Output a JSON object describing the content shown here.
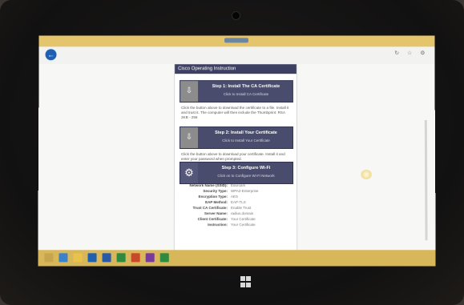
{
  "browser": {
    "url": "",
    "back_icon": "arrow-left-icon",
    "tools_icons": [
      "refresh-icon",
      "favorites-icon",
      "settings-icon"
    ]
  },
  "page": {
    "header_title": "Cisco Operating Instruction",
    "steps": [
      {
        "title": "Step 1: Install The CA Certificate",
        "subtitle": "Click to Install CA Certificate",
        "icon": "download-icon"
      },
      {
        "title": "Step 2: Install Your Certificate",
        "subtitle": "Click to Install Your Certificate",
        "icon": "download-icon"
      },
      {
        "title": "Step 3: Configure Wi-Fi",
        "subtitle": "Click on to Configure Wi-Fi Network",
        "icon": "gear-icon"
      }
    ],
    "para1": "Click the button above to download the certificate to a file. Install it and trust it. The computer will then include the Thumbprint: RSA 2KB - 256",
    "para2": "Click the button above to download your certificate. Install it and enter your password when prompted.",
    "settings": [
      {
        "key": "Network Name (SSID):",
        "value": "Eduroam"
      },
      {
        "key": "Security Type:",
        "value": "WPA2-Enterprise"
      },
      {
        "key": "Encryption Type:",
        "value": "AES"
      },
      {
        "key": "EAP Method:",
        "value": "EAP-TLS"
      },
      {
        "key": "Trust CA Certificate:",
        "value": "Enable Trust"
      },
      {
        "key": "Server Name:",
        "value": "radius.domain"
      },
      {
        "key": "Client Certificate:",
        "value": "Your Certificate"
      },
      {
        "key": "Instruction:",
        "value": "Your Certificate"
      }
    ],
    "footnote": ""
  },
  "taskbar": {
    "icons": [
      {
        "name": "start-icon",
        "color": "#c9a44e"
      },
      {
        "name": "ie-icon",
        "color": "#3a83c9"
      },
      {
        "name": "file-explorer-icon",
        "color": "#e8c24a"
      },
      {
        "name": "outlook-icon",
        "color": "#1f5fb0"
      },
      {
        "name": "word-icon",
        "color": "#2a5aa6"
      },
      {
        "name": "excel-icon",
        "color": "#2d8a3e"
      },
      {
        "name": "powerpoint-icon",
        "color": "#c8482a"
      },
      {
        "name": "onenote-icon",
        "color": "#7a3a9a"
      },
      {
        "name": "publisher-icon",
        "color": "#2d8a3e"
      }
    ],
    "tray": ""
  }
}
